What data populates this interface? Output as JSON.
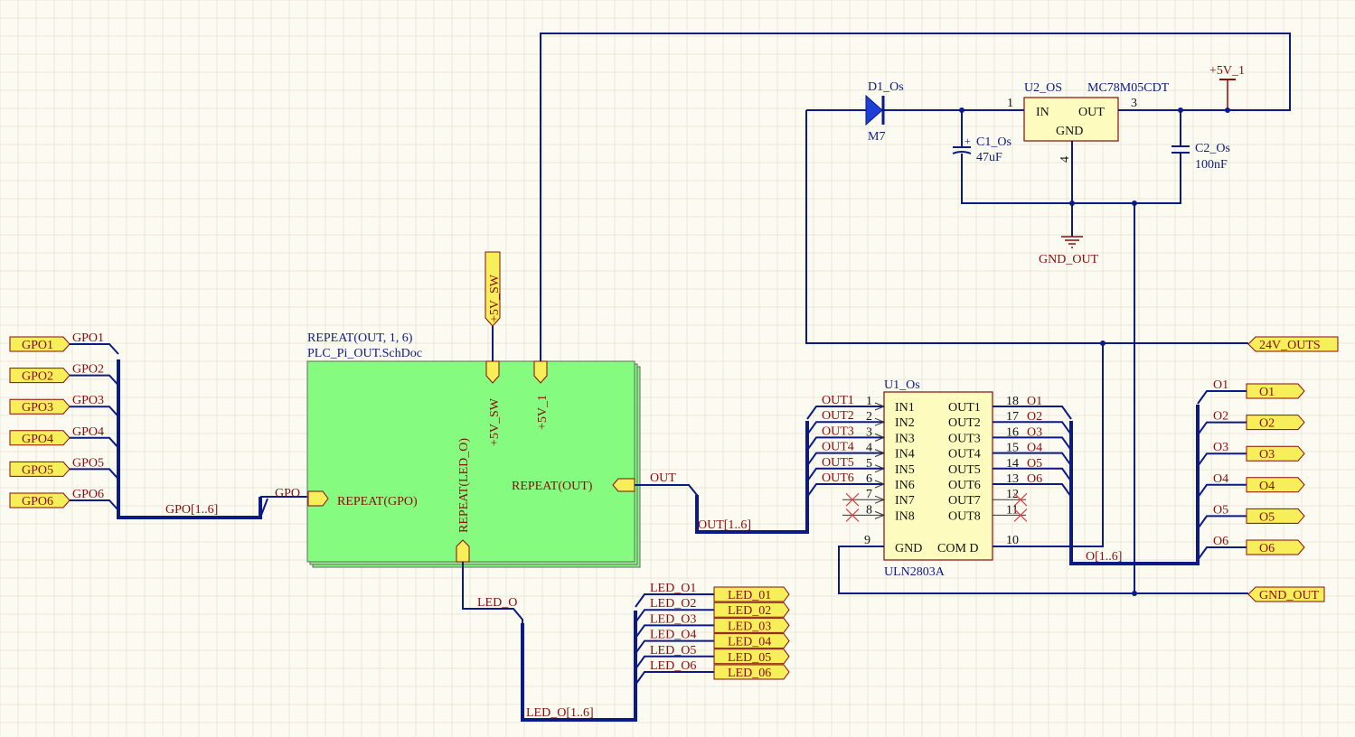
{
  "gpo_ports": [
    "GPO1",
    "GPO2",
    "GPO3",
    "GPO4",
    "GPO5",
    "GPO6"
  ],
  "gpo_nets": [
    "GPO1",
    "GPO2",
    "GPO3",
    "GPO4",
    "GPO5",
    "GPO6"
  ],
  "gpo_bus_label": "GPO[1..6]",
  "gpo_net": "GPO",
  "sheet": {
    "designator": "REPEAT(OUT, 1, 6)",
    "filename": "PLC_Pi_OUT.SchDoc",
    "entry_gpo": "REPEAT(GPO)",
    "entry_out": "REPEAT(OUT)",
    "entry_led": "REPEAT(LED_O)",
    "entry_5vsw": "+5V_SW",
    "entry_5v1": "+5V_1"
  },
  "port_5vsw": "+5V_SW",
  "out_net": "OUT",
  "out_bus_label": "OUT[1..6]",
  "out_nets": [
    "OUT1",
    "OUT2",
    "OUT3",
    "OUT4",
    "OUT5",
    "OUT6"
  ],
  "led_net": "LED_O",
  "led_bus_label": "LED_O[1..6]",
  "led_nets": [
    "LED_O1",
    "LED_O2",
    "LED_O3",
    "LED_O4",
    "LED_O5",
    "LED_O6"
  ],
  "led_ports": [
    "LED_01",
    "LED_02",
    "LED_03",
    "LED_04",
    "LED_05",
    "LED_06"
  ],
  "u1": {
    "designator": "U1_Os",
    "comment": "ULN2803A",
    "left_pins": [
      "IN1",
      "IN2",
      "IN3",
      "IN4",
      "IN5",
      "IN6",
      "IN7",
      "IN8"
    ],
    "left_nums": [
      "1",
      "2",
      "3",
      "4",
      "5",
      "6",
      "7",
      "8"
    ],
    "right_pins": [
      "OUT1",
      "OUT2",
      "OUT3",
      "OUT4",
      "OUT5",
      "OUT6",
      "OUT7",
      "OUT8"
    ],
    "right_nums": [
      "18",
      "17",
      "16",
      "15",
      "14",
      "13",
      "12",
      "11"
    ],
    "gnd_label": "GND",
    "com_label": "COM D",
    "gnd_num": "9",
    "com_num": "10"
  },
  "o_nets_u1": [
    "O1",
    "O2",
    "O3",
    "O4",
    "O5",
    "O6"
  ],
  "o_bus_label": "O[1..6]",
  "o_nets_right": [
    "O1",
    "O2",
    "O3",
    "O4",
    "O5",
    "O6"
  ],
  "o_ports": [
    "O1",
    "O2",
    "O3",
    "O4",
    "O5",
    "O6"
  ],
  "port_24v": "24V_OUTS",
  "port_gnd_out": "GND_OUT",
  "d1": {
    "designator": "D1_Os",
    "comment": "M7"
  },
  "u2": {
    "designator": "U2_OS",
    "comment": "MC78M05CDT",
    "in": "IN",
    "out": "OUT",
    "gnd": "GND",
    "pin_in": "1",
    "pin_out": "3",
    "pin_gnd": "4"
  },
  "c1": {
    "designator": "C1_Os",
    "value": "47uF"
  },
  "c2": {
    "designator": "C2_Os",
    "value": "100nF"
  },
  "pwr_5v1": "+5V_1",
  "gnd_symbol_label": "GND_OUT",
  "colors": {
    "wire": "#0c1a85",
    "label": "#8a0b0b",
    "port_fill": "#f7ef5a",
    "sheet_fill": "#85fb7f",
    "comp_fill": "#fdfbbd"
  }
}
